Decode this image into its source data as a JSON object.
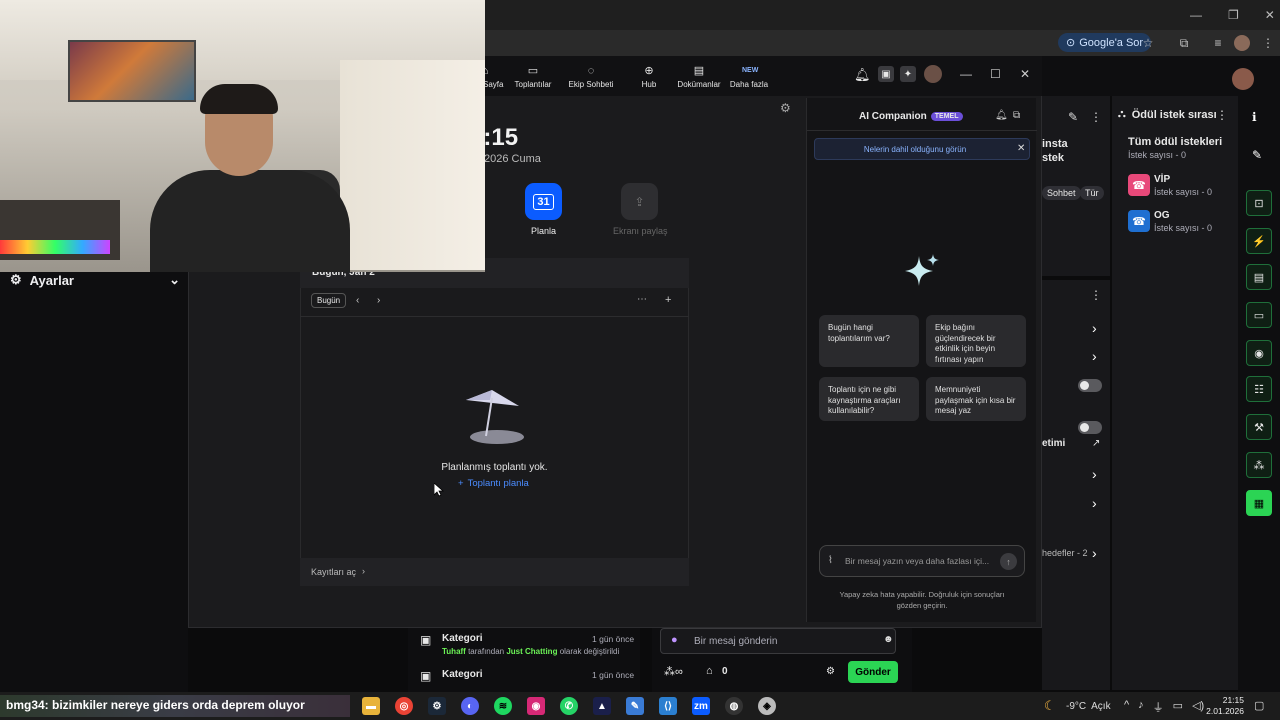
{
  "browser": {
    "search_pill": "Google'a Sor"
  },
  "left_panel": {
    "settings_label": "Ayarlar"
  },
  "zoom": {
    "nav": [
      {
        "label": "Ana Sayfa",
        "icon": "home-icon"
      },
      {
        "label": "Toplantılar",
        "icon": "video-icon"
      },
      {
        "label": "Ekip Sohbeti",
        "icon": "chat-icon"
      },
      {
        "label": "Hub",
        "icon": "hub-icon"
      },
      {
        "label": "Dokümanlar",
        "icon": "doc-icon"
      },
      {
        "label": "Daha fazla",
        "icon": "more-icon",
        "badge": "NEW"
      }
    ],
    "clock": "1:15",
    "date": "2026 Cuma",
    "actions": [
      {
        "label": "Planla",
        "icon": "calendar-icon",
        "day": "31"
      },
      {
        "label": "Ekranı paylaş",
        "icon": "share-screen-icon"
      }
    ],
    "calendar": {
      "header": "Bugün, Jan 2",
      "today_btn": "Bugün",
      "empty_text": "Planlanmış toplantı yok.",
      "schedule_link": "Toplantı planla",
      "recordings": "Kayıtları aç"
    },
    "ai": {
      "title": "AI Companion",
      "badge": "TEMEL",
      "banner": "Nelerin dahil olduğunu görün",
      "chips": [
        "Bugün hangi toplantılarım var?",
        "Ekip bağını güçlendirecek bir etkinlik için beyin fırtınası yapın",
        "Toplantı için ne gibi kaynaştırma araçları kullanılabilir?",
        "Memnuniyeti paylaşmak için kısa bir mesaj yaz"
      ],
      "input_placeholder": "Bir mesaj yazın veya daha fazlası içi...",
      "disclaimer": "Yapay zeka hata yapabilir. Doğruluk için sonuçları gözden geçirin."
    }
  },
  "stream_bg": {
    "partial_title_1": "insta",
    "partial_title_2": "stek",
    "tag1": "Sohbet",
    "tag2": "Tür",
    "partial_3": "etimi",
    "partial_4": "hedefler - 2"
  },
  "rewards": {
    "title": "Ödül istek sırası",
    "all_title": "Tüm ödül istekleri",
    "all_count": "İstek sayısı - 0",
    "items": [
      {
        "name": "VİP",
        "count": "İstek sayısı - 0",
        "color": "#e8497a"
      },
      {
        "name": "OG",
        "count": "İstek sayısı - 0",
        "color": "#1f6fd1"
      }
    ]
  },
  "activity": [
    {
      "title": "Kategori",
      "time": "1 gün önce",
      "user": "Tuhaff",
      "mid": "tarafından",
      "cat": "Just Chatting",
      "end": "olarak değiştirildi"
    },
    {
      "title": "Kategori",
      "time": "1 gün önce"
    }
  ],
  "chat": {
    "placeholder": "Bir mesaj gönderin",
    "points": "0",
    "send": "Gönder"
  },
  "taskbar": {
    "ticker": "bmg34: bizimkiler nereye giders orda deprem oluyor",
    "weather": "-9°C  Açık",
    "time": "21:15",
    "date": "2.01.2026"
  }
}
